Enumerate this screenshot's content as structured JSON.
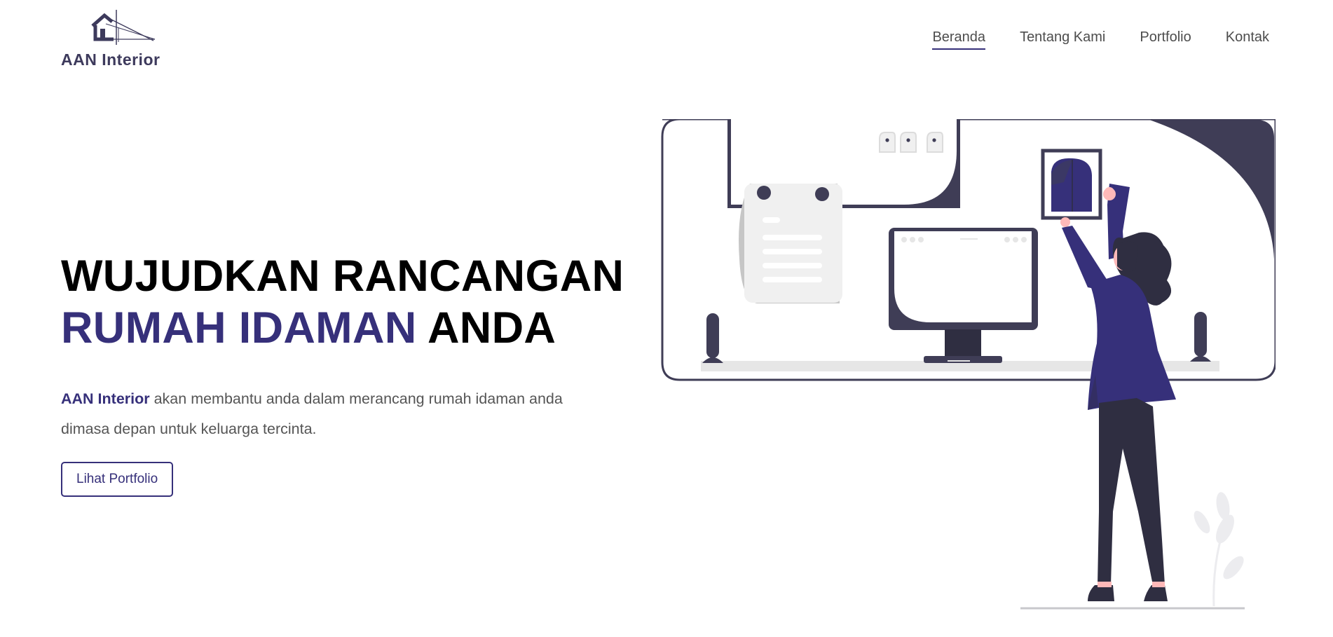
{
  "brand": {
    "name": "AAN Interior"
  },
  "nav": {
    "items": [
      {
        "label": "Beranda",
        "active": true
      },
      {
        "label": "Tentang Kami",
        "active": false
      },
      {
        "label": "Portfolio",
        "active": false
      },
      {
        "label": "Kontak",
        "active": false
      }
    ]
  },
  "hero": {
    "title_line1": "WUJUDKAN RANCANGAN",
    "title_accent": "RUMAH IDAMAN",
    "title_rest": "ANDA",
    "desc_brand": "AAN Interior",
    "desc_text": " akan membantu anda dalam merancang rumah idaman anda dimasa depan untuk keluarga tercinta.",
    "cta_label": "Lihat Portfolio"
  },
  "colors": {
    "accent": "#36307a",
    "dark": "#3f3d56",
    "text": "#4d4d4d",
    "muted": "#555555"
  },
  "icons": {
    "logo": "house-blueprint-logo",
    "illustration": "woman-hanging-picture-illustration"
  }
}
